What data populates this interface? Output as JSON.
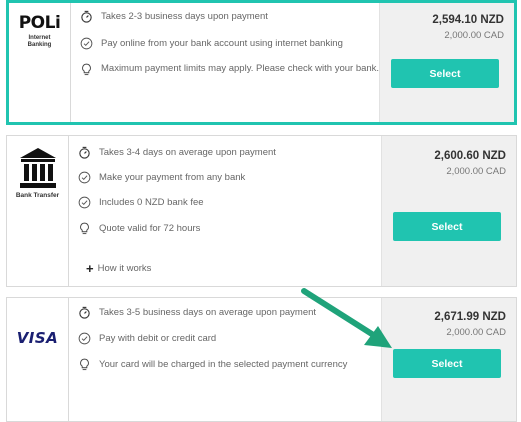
{
  "options": [
    {
      "logo": {
        "name": "POLi",
        "sub": "Internet Banking"
      },
      "features": [
        {
          "icon": "stopwatch-icon",
          "text": "Takes 2-3 business days upon payment"
        },
        {
          "icon": "check-circle-icon",
          "text": "Pay online from your bank account using internet banking"
        },
        {
          "icon": "lightbulb-icon",
          "text": "Maximum payment limits may apply. Please check with your bank."
        }
      ],
      "price_main": "2,594.10 NZD",
      "price_sub": "2,000.00 CAD",
      "select_label": "Select"
    },
    {
      "logo": {
        "name": "Bank Transfer"
      },
      "features": [
        {
          "icon": "stopwatch-icon",
          "text": "Takes 3-4 days on average upon payment"
        },
        {
          "icon": "check-circle-icon",
          "text": "Make your payment from any bank"
        },
        {
          "icon": "check-circle-icon",
          "text": "Includes 0 NZD bank fee"
        },
        {
          "icon": "lightbulb-icon",
          "text": "Quote valid for 72 hours"
        }
      ],
      "how_it_works": "How it works",
      "price_main": "2,600.60 NZD",
      "price_sub": "2,000.00 CAD",
      "select_label": "Select"
    },
    {
      "logo": {
        "name": "VISA"
      },
      "features": [
        {
          "icon": "stopwatch-icon",
          "text": "Takes 3-5 business days on average upon payment"
        },
        {
          "icon": "check-circle-icon",
          "text": "Pay with debit or credit card"
        },
        {
          "icon": "lightbulb-icon",
          "text": "Your card will be charged in the selected payment currency"
        }
      ],
      "price_main": "2,671.99 NZD",
      "price_sub": "2,000.00 CAD",
      "select_label": "Select"
    }
  ],
  "colors": {
    "accent": "#20c4b0",
    "arrow": "#1fa37a"
  }
}
